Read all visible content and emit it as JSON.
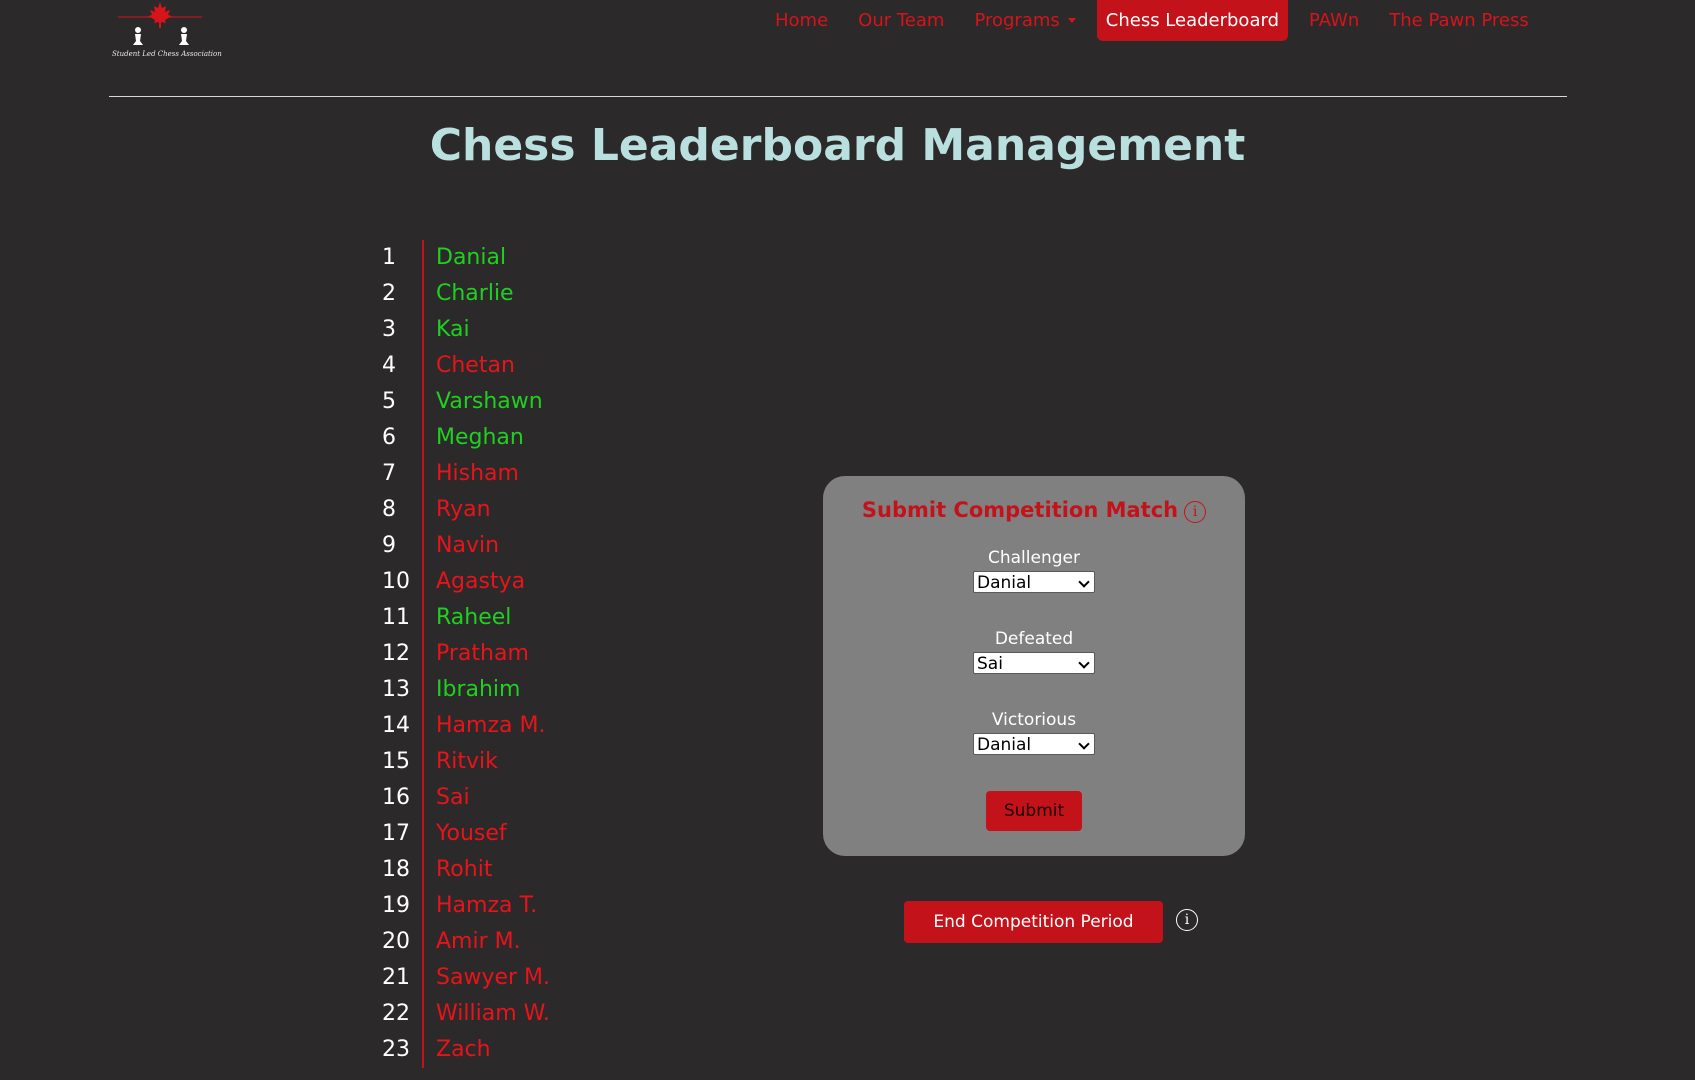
{
  "header": {
    "logo_text": "Student Led Chess Association",
    "nav": [
      {
        "label": "Home",
        "active": false
      },
      {
        "label": "Our Team",
        "active": false
      },
      {
        "label": "Programs",
        "active": false,
        "dropdown": true
      },
      {
        "label": "Chess Leaderboard",
        "active": true
      },
      {
        "label": "PAWn",
        "active": false
      },
      {
        "label": "The Pawn Press",
        "active": false
      }
    ]
  },
  "page": {
    "title": "Chess Leaderboard Management"
  },
  "leaderboard": [
    {
      "rank": "1",
      "name": "Danial",
      "status": "green"
    },
    {
      "rank": "2",
      "name": "Charlie",
      "status": "green"
    },
    {
      "rank": "3",
      "name": "Kai",
      "status": "green"
    },
    {
      "rank": "4",
      "name": "Chetan",
      "status": "red"
    },
    {
      "rank": "5",
      "name": "Varshawn",
      "status": "green"
    },
    {
      "rank": "6",
      "name": "Meghan",
      "status": "green"
    },
    {
      "rank": "7",
      "name": "Hisham",
      "status": "red"
    },
    {
      "rank": "8",
      "name": "Ryan",
      "status": "red"
    },
    {
      "rank": "9",
      "name": "Navin",
      "status": "red"
    },
    {
      "rank": "10",
      "name": "Agastya",
      "status": "red"
    },
    {
      "rank": "11",
      "name": "Raheel",
      "status": "green"
    },
    {
      "rank": "12",
      "name": "Pratham",
      "status": "red"
    },
    {
      "rank": "13",
      "name": "Ibrahim",
      "status": "green"
    },
    {
      "rank": "14",
      "name": "Hamza M.",
      "status": "red"
    },
    {
      "rank": "15",
      "name": "Ritvik",
      "status": "red"
    },
    {
      "rank": "16",
      "name": "Sai",
      "status": "red"
    },
    {
      "rank": "17",
      "name": "Yousef",
      "status": "red"
    },
    {
      "rank": "18",
      "name": "Rohit",
      "status": "red"
    },
    {
      "rank": "19",
      "name": "Hamza T.",
      "status": "red"
    },
    {
      "rank": "20",
      "name": "Amir M.",
      "status": "red"
    },
    {
      "rank": "21",
      "name": "Sawyer M.",
      "status": "red"
    },
    {
      "rank": "22",
      "name": "William W.",
      "status": "red"
    },
    {
      "rank": "23",
      "name": "Zach",
      "status": "red"
    }
  ],
  "form": {
    "title": "Submit Competition Match",
    "challenger_label": "Challenger",
    "challenger_value": "Danial",
    "defeated_label": "Defeated",
    "defeated_value": "Sai",
    "victorious_label": "Victorious",
    "victorious_value": "Danial",
    "submit_label": "Submit",
    "info_glyph": "i"
  },
  "end_competition": {
    "label": "End Competition Period",
    "info_glyph": "i"
  },
  "colors": {
    "background": "#2b292a",
    "accent": "#c4121a",
    "title": "#b9e0df",
    "card": "#808080",
    "winning": "#20d020",
    "losing": "#e8141a"
  }
}
